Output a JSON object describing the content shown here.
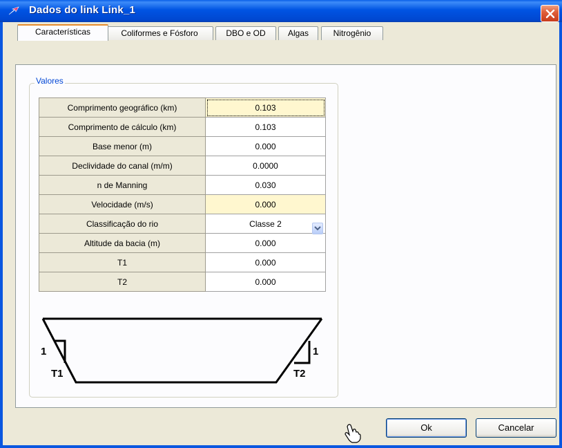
{
  "window": {
    "title": "Dados do link Link_1"
  },
  "tabs": [
    {
      "label": "Características",
      "active": true
    },
    {
      "label": "Coliformes e Fósforo",
      "active": false
    },
    {
      "label": "DBO e OD",
      "active": false
    },
    {
      "label": "Algas",
      "active": false
    },
    {
      "label": "Nitrogênio",
      "active": false
    }
  ],
  "group": {
    "label": "Valores"
  },
  "grid": {
    "rows": [
      {
        "label": "Comprimento geográfico (km)",
        "value": "0.103"
      },
      {
        "label": "Comprimento de cálculo (km)",
        "value": "0.103"
      },
      {
        "label": "Base menor (m)",
        "value": "0.000"
      },
      {
        "label": "Declividade do canal (m/m)",
        "value": "0.0000"
      },
      {
        "label": "n de Manning",
        "value": "0.030"
      },
      {
        "label": "Velocidade (m/s)",
        "value": "0.000"
      },
      {
        "label": "Classificação do rio",
        "value": "Classe 2"
      },
      {
        "label": "Altitude da bacia (m)",
        "value": "0.000"
      },
      {
        "label": "T1",
        "value": "0.000"
      },
      {
        "label": "T2",
        "value": "0.000"
      }
    ]
  },
  "diagram": {
    "left_slope_label": "1",
    "left_t_label": "T1",
    "right_slope_label": "1",
    "right_t_label": "T2"
  },
  "buttons": {
    "ok": "Ok",
    "cancel": "Cancelar"
  },
  "colors": {
    "titlebar": "#0054e3",
    "highlight_cell": "#fff7cf",
    "dialog_bg": "#ece9d8"
  }
}
